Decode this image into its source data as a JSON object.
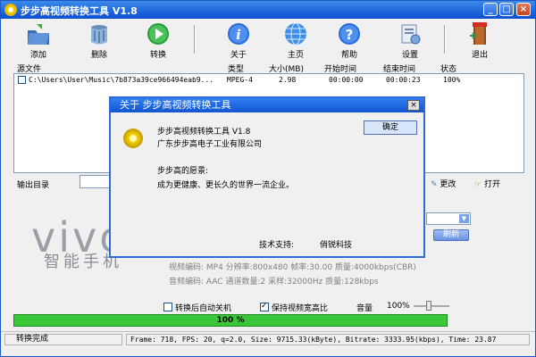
{
  "window": {
    "title": "步步高视频转换工具 V1.8",
    "min": "_",
    "max": "□",
    "close": "×"
  },
  "toolbar": {
    "add": "添加",
    "delete": "删除",
    "convert": "转换",
    "about": "关于",
    "home": "主页",
    "help": "帮助",
    "settings": "设置",
    "exit": "退出"
  },
  "list": {
    "headers": {
      "source": "源文件",
      "type": "类型",
      "size": "大小(MB)",
      "start": "开始时间",
      "end": "结束时间",
      "status": "状态"
    },
    "rows": [
      {
        "source": "C:\\Users\\User\\Music\\7b873a39ce966494eab9...",
        "type": "MPEG-4",
        "size": "2.98",
        "start": "00:00:00",
        "end": "00:00:23",
        "status": "100%"
      }
    ]
  },
  "output": {
    "label": "输出目录",
    "change": "更改",
    "open": "打开",
    "refresh": "刷新"
  },
  "logo": {
    "brand": "vivo",
    "tagline": "智能手机"
  },
  "info": {
    "video": "视频编码:  MP4   分辨率:800x480   帧率:30.00   质量:4000kbps(CBR)",
    "audio": "音频编码:  AAC   通道数量:2   采样:32000Hz   质量:128kbps"
  },
  "options": {
    "shutdown": "转换后自动关机",
    "keep_ratio": "保持视频宽高比",
    "volume_label": "音量",
    "volume_value": "100%"
  },
  "progress": {
    "value": 1.0,
    "label": "100 %"
  },
  "status": {
    "left": "转换完成",
    "right": "Frame: 718,  FPS: 20,  q=2.0, Size: 9715.33(kByte), Bitrate: 3333.95(kbps),  Time: 23.87"
  },
  "dialog": {
    "title": "关于 步步高视频转换工具",
    "close": "×",
    "ok": "确定",
    "product": "步步高视频转换工具  V1.8",
    "company": "广东步步高电子工业有限公司",
    "vision_title": "步步高的愿景:",
    "vision_text": "成为更健康、更长久的世界一流企业。",
    "support_label": "技术支持:",
    "support_value": "俏锐科技"
  },
  "colors": {
    "title_blue": "#0b4fd0",
    "progress_green": "#39c639"
  }
}
